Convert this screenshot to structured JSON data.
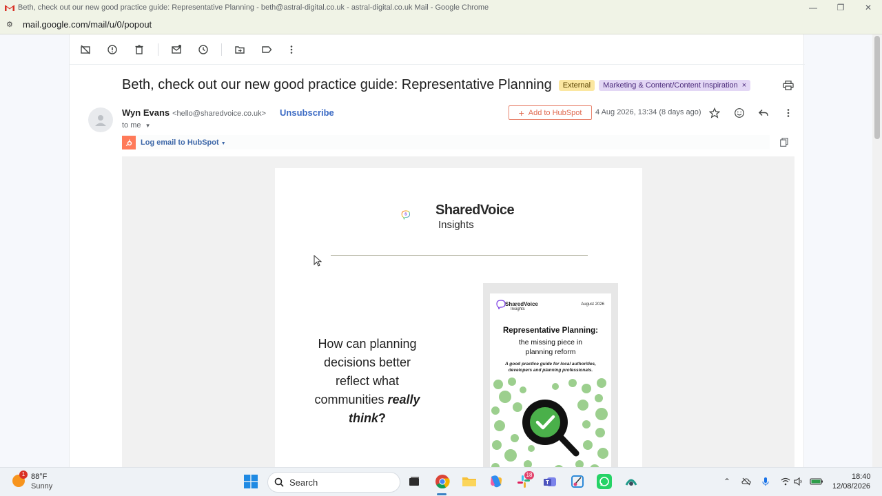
{
  "window": {
    "title": "Beth, check out our new good practice guide: Representative Planning - beth@astral-digital.co.uk - astral-digital.co.uk Mail - Google Chrome",
    "url": "mail.google.com/mail/u/0/popout"
  },
  "toolbar": {
    "icons": [
      "archive-icon",
      "report-spam-icon",
      "delete-icon",
      "mark-unread-icon",
      "snooze-icon",
      "move-to-icon",
      "label-icon",
      "more-icon"
    ]
  },
  "email": {
    "subject": "Beth, check out our new good practice guide: Representative Planning",
    "tag_external": "External",
    "tag_label": "Marketing & Content/Content Inspiration",
    "tag_label_close": "×",
    "sender_name": "Wyn Evans",
    "sender_email": "<hello@sharedvoice.co.uk>",
    "unsubscribe": "Unsubscribe",
    "to": "to me",
    "add_to_hubspot": "Add to HubSpot",
    "date": "4 Aug 2026, 13:34 (8 days ago)",
    "log_to_hubspot": "Log email to HubSpot"
  },
  "body": {
    "brand_name": "SharedVoice",
    "brand_sub": "Insights",
    "question_lines": [
      "How can planning",
      "decisions better",
      "reflect what"
    ],
    "question_line4": "communities ",
    "question_emph1": "really",
    "question_emph2": "think",
    "question_end": "?",
    "cover": {
      "brand": "SharedVoice",
      "brand_sub": "Insights",
      "date": "August 2026",
      "title": "Representative Planning:",
      "subtitle1": "the missing piece in",
      "subtitle2": "planning reform",
      "description": "A good practice guide for local authorities, developers and planning professionals."
    }
  },
  "taskbar": {
    "temperature": "88°F",
    "condition": "Sunny",
    "weather_badge": "1",
    "search_label": "Search",
    "teams_badge": "18",
    "time": "18:40",
    "date": "12/08/2026"
  },
  "colors": {
    "hubspot_orange": "#ff7a59",
    "external_chip": "#fbe7a1",
    "label_chip": "#e3d7f5",
    "link_blue": "#3c6bc4"
  }
}
